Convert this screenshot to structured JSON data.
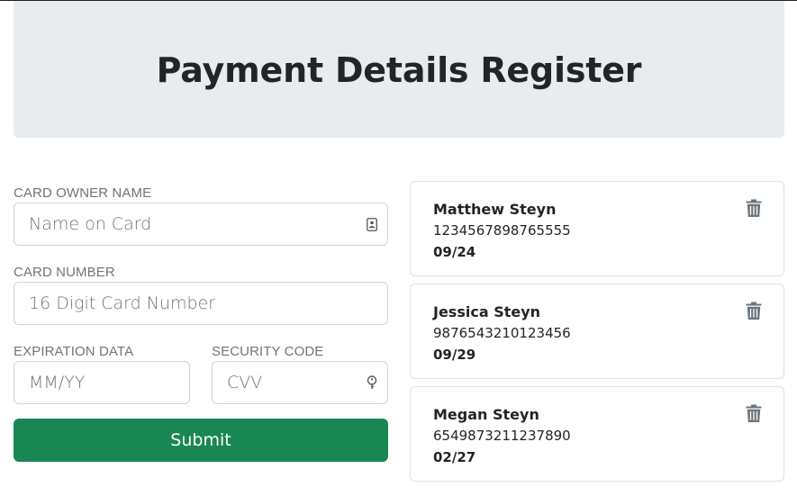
{
  "header": {
    "title": "Payment Details Register"
  },
  "form": {
    "owner": {
      "label": "CARD OWNER NAME",
      "placeholder": "Name on Card",
      "icon": "contact-card-icon"
    },
    "number": {
      "label": "CARD NUMBER",
      "placeholder": "16 Digit Card Number"
    },
    "expiry": {
      "label": "EXPIRATION DATA",
      "placeholder": "MM/YY"
    },
    "security": {
      "label": "SECURITY CODE",
      "placeholder": "CVV",
      "icon": "key-icon"
    },
    "submit_label": "Submit"
  },
  "cards": [
    {
      "name": "Matthew Steyn",
      "number": "1234567898765555",
      "expiry": "09/24"
    },
    {
      "name": "Jessica Steyn",
      "number": "9876543210123456",
      "expiry": "09/29"
    },
    {
      "name": "Megan Steyn",
      "number": "6549873211237890",
      "expiry": "02/27"
    }
  ],
  "colors": {
    "submit": "#198754",
    "header_bg": "#e9ecef",
    "trash": "#6c757d"
  },
  "icons": {
    "delete": "trash-icon"
  }
}
